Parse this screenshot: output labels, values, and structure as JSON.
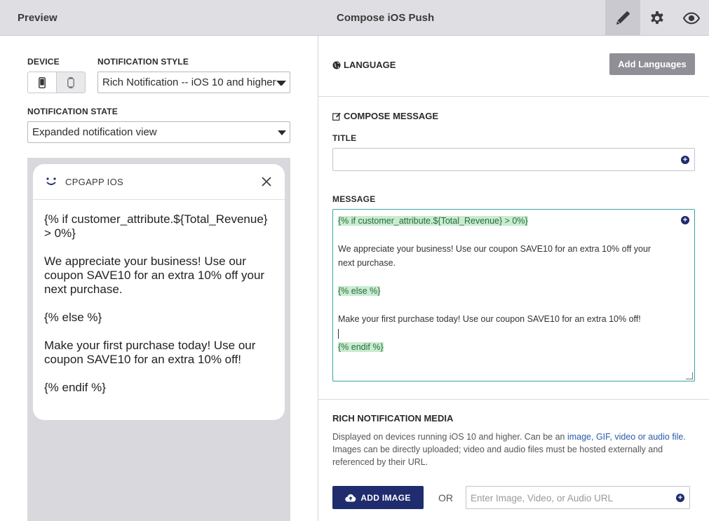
{
  "topbar": {
    "preview_title": "Preview",
    "compose_title": "Compose iOS Push",
    "buttons": [
      {
        "icon": "pencil-icon",
        "active": true
      },
      {
        "icon": "gear-icon",
        "active": false
      },
      {
        "icon": "eye-icon",
        "active": false
      }
    ]
  },
  "left": {
    "device_label": "DEVICE",
    "device_options": [
      "phone-icon",
      "watch-icon"
    ],
    "style_label": "NOTIFICATION STYLE",
    "style_value": "Rich Notification -- iOS 10 and higher",
    "state_label": "NOTIFICATION STATE",
    "state_value": "Expanded notification view",
    "notification": {
      "app_name": "CPGAPP IOS",
      "lines": [
        "{% if customer_attribute.${Total_Revenue} > 0%}",
        "We appreciate your business! Use our coupon SAVE10 for an extra 10% off your next purchase.",
        "{% else %}",
        "Make your first purchase today! Use our coupon SAVE10 for an extra 10% off!",
        "{% endif %}"
      ]
    }
  },
  "right": {
    "language": {
      "title": "LANGUAGE",
      "add_button": "Add Languages"
    },
    "compose": {
      "title": "COMPOSE MESSAGE",
      "title_label": "TITLE",
      "title_value": "",
      "message_label": "MESSAGE",
      "message_lines": [
        {
          "text": "{% if customer_attribute.${Total_Revenue} > 0%}",
          "tag": true
        },
        {
          "text": "",
          "tag": false
        },
        {
          "text": "We appreciate your business! Use our coupon SAVE10 for an extra 10% off your",
          "tag": false
        },
        {
          "text": "next purchase.",
          "tag": false
        },
        {
          "text": "",
          "tag": false
        },
        {
          "text": "{% else %}",
          "tag": true
        },
        {
          "text": "",
          "tag": false
        },
        {
          "text": "Make your first purchase today! Use our coupon SAVE10 for an extra 10% off!",
          "tag": false
        },
        {
          "text": "",
          "tag": false,
          "cursor": true
        },
        {
          "text": "{% endif %}",
          "tag": true
        }
      ]
    },
    "rich_media": {
      "title": "RICH NOTIFICATION MEDIA",
      "desc_prefix": "Displayed on devices running iOS 10 and higher. Can be an ",
      "desc_link": "image, GIF, video or audio file",
      "desc_suffix": ".",
      "desc_line2": "Images can be directly uploaded; video and audio files must be hosted externally and referenced by their URL.",
      "add_image_label": "ADD IMAGE",
      "or_label": "OR",
      "url_placeholder": "Enter Image, Video, or Audio URL"
    }
  },
  "colors": {
    "accent": "#1f2c6e",
    "tag_bg": "#c9ecd1",
    "focus_border": "#3aa3a3"
  }
}
